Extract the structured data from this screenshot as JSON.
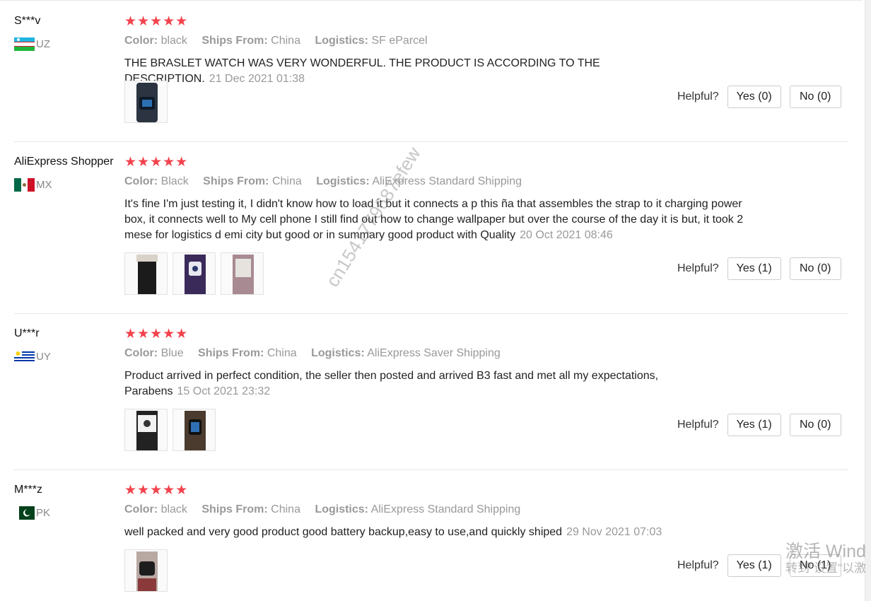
{
  "ui": {
    "color_key": "Color:",
    "ships_key": "Ships From:",
    "logistics_key": "Logistics:",
    "helpful_label": "Helpful?",
    "star_glyphs": "★★★★★"
  },
  "colors": {
    "star": "#f2434d",
    "meta_text": "#999999",
    "border": "#cccccc"
  },
  "reviews": [
    {
      "user": "S***v",
      "country": "UZ",
      "flag": "uzbekistan-flag",
      "rating": 5,
      "color": "black",
      "ships_from": "China",
      "logistics": "SF eParcel",
      "text": "THE BRASLET WATCH WAS VERY WONDERFUL. THE PRODUCT IS ACCORDING TO THE DESCRIPTION.",
      "date": "21 Dec 2021 01:38",
      "photos": 1,
      "yes_label": "Yes (0)",
      "no_label": "No (0)"
    },
    {
      "user": "AliExpress Shopper",
      "country": "MX",
      "flag": "mexico-flag",
      "rating": 5,
      "color": "Black",
      "ships_from": "China",
      "logistics": "AliExpress Standard Shipping",
      "text": "It's fine I'm just testing it, I didn't know how to load it but it connects a p this ña that assembles the strap to it charging power box, it connects well to My cell phone I still find out how to change wallpaper but over the course of the day it is but, it took 2 mese for logistics d emi city but good or in summary good product with Quality",
      "date": "20 Oct 2021 08:46",
      "photos": 3,
      "yes_label": "Yes (1)",
      "no_label": "No (0)"
    },
    {
      "user": "U***r",
      "country": "UY",
      "flag": "uruguay-flag",
      "rating": 5,
      "color": "Blue",
      "ships_from": "China",
      "logistics": "AliExpress Saver Shipping",
      "text": "Product arrived in perfect condition, the seller then posted and arrived B3 fast and met all my expectations, Parabens",
      "date": "15 Oct 2021 23:32",
      "photos": 2,
      "yes_label": "Yes (1)",
      "no_label": "No (0)"
    },
    {
      "user": "M***z",
      "country": "PK",
      "flag": "pakistan-flag",
      "rating": 5,
      "color": "black",
      "ships_from": "China",
      "logistics": "AliExpress Standard Shipping",
      "text": "well packed and very good product good battery backup,easy to use,and quickly shiped",
      "date": "29 Nov 2021 07:03",
      "photos": 1,
      "yes_label": "Yes (1)",
      "no_label": "No (1)"
    }
  ],
  "overlay": {
    "watermark": "cn1541779687efew",
    "windows_line1": "激活 Wind",
    "windows_line2": "转到\"设置\"以激"
  }
}
